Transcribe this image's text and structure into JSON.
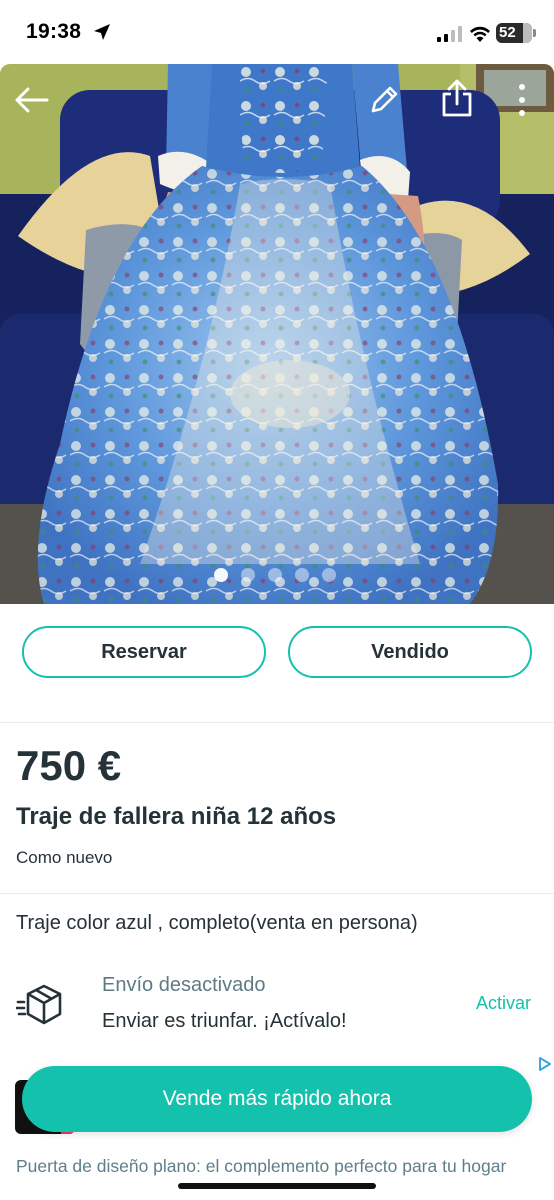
{
  "status_bar": {
    "time": "19:38",
    "battery": "52",
    "icons": [
      "location-arrow-icon",
      "signal-icon",
      "wifi-icon",
      "battery-icon"
    ]
  },
  "photo": {
    "image_count": 5,
    "active_index": 0,
    "icons": [
      "back-arrow-icon",
      "pencil-icon",
      "share-icon",
      "more-vertical-icon"
    ]
  },
  "actions": {
    "reserve_label": "Reservar",
    "sold_label": "Vendido"
  },
  "listing": {
    "price": "750 €",
    "title": "Traje de fallera niña 12 años",
    "condition": "Como nuevo",
    "description": "Traje color azul , completo(venta en persona)"
  },
  "shipping": {
    "title": "Envío desactivado",
    "subtitle": "Enviar es triunfar. ¡Actívalo!",
    "action_label": "Activar"
  },
  "promo": {
    "cta_label": "Vende más rápido ahora",
    "ad_text": "Puerta de diseño plano: el complemento perfecto para tu hogar"
  },
  "colors": {
    "accent": "#13c1ac",
    "text_primary": "#253238",
    "text_secondary": "#5f7a85"
  }
}
